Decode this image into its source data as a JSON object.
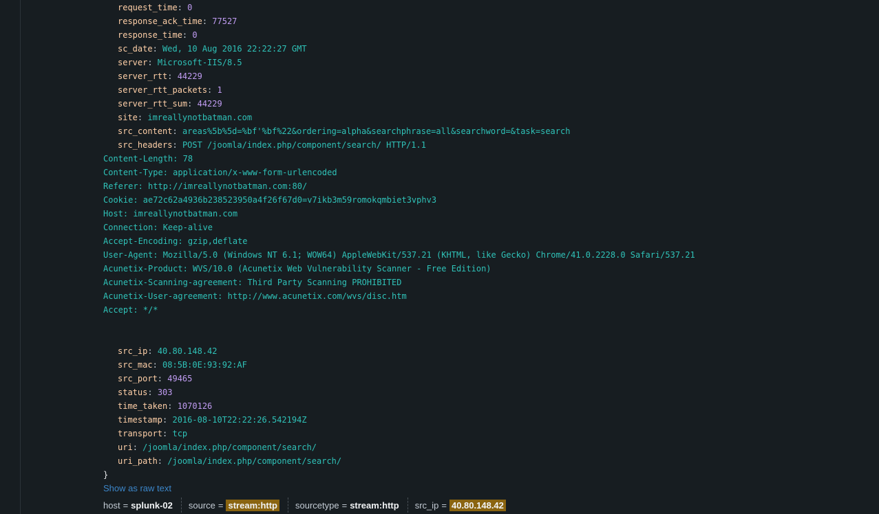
{
  "fields_top": [
    {
      "key": "request_time",
      "value": "0",
      "type": "num"
    },
    {
      "key": "response_ack_time",
      "value": "77527",
      "type": "num"
    },
    {
      "key": "response_time",
      "value": "0",
      "type": "num"
    },
    {
      "key": "sc_date",
      "value": "Wed, 10 Aug 2016 22:22:27 GMT",
      "type": "str"
    },
    {
      "key": "server",
      "value": "Microsoft-IIS/8.5",
      "type": "str"
    },
    {
      "key": "server_rtt",
      "value": "44229",
      "type": "num"
    },
    {
      "key": "server_rtt_packets",
      "value": "1",
      "type": "num"
    },
    {
      "key": "server_rtt_sum",
      "value": "44229",
      "type": "num"
    },
    {
      "key": "site",
      "value": "imreallynotbatman.com",
      "type": "str"
    },
    {
      "key": "src_content",
      "value": "areas%5b%5d=%bf'%bf%22&ordering=alpha&searchphrase=all&searchword=&task=search",
      "type": "str"
    },
    {
      "key": "src_headers",
      "value": "POST /joomla/index.php/component/search/ HTTP/1.1",
      "type": "str"
    }
  ],
  "header_lines": [
    "Content-Length: 78",
    "Content-Type: application/x-www-form-urlencoded",
    "Referer: http://imreallynotbatman.com:80/",
    "Cookie: ae72c62a4936b238523950a4f26f67d0=v7ikb3m59romokqmbiet3vphv3",
    "Host: imreallynotbatman.com",
    "Connection: Keep-alive",
    "Accept-Encoding: gzip,deflate",
    "User-Agent: Mozilla/5.0 (Windows NT 6.1; WOW64) AppleWebKit/537.21 (KHTML, like Gecko) Chrome/41.0.2228.0 Safari/537.21",
    "Acunetix-Product: WVS/10.0 (Acunetix Web Vulnerability Scanner - Free Edition)",
    "Acunetix-Scanning-agreement: Third Party Scanning PROHIBITED",
    "Acunetix-User-agreement: http://www.acunetix.com/wvs/disc.htm",
    "Accept: */*"
  ],
  "fields_bottom": [
    {
      "key": "src_ip",
      "value": "40.80.148.42",
      "type": "str"
    },
    {
      "key": "src_mac",
      "value": "08:5B:0E:93:92:AF",
      "type": "str"
    },
    {
      "key": "src_port",
      "value": "49465",
      "type": "num"
    },
    {
      "key": "status",
      "value": "303",
      "type": "num"
    },
    {
      "key": "time_taken",
      "value": "1070126",
      "type": "num"
    },
    {
      "key": "timestamp",
      "value": "2016-08-10T22:22:26.542194Z",
      "type": "str"
    },
    {
      "key": "transport",
      "value": "tcp",
      "type": "str"
    },
    {
      "key": "uri",
      "value": "/joomla/index.php/component/search/",
      "type": "str"
    },
    {
      "key": "uri_path",
      "value": "/joomla/index.php/component/search/",
      "type": "str"
    }
  ],
  "closing_brace": "}",
  "colon": ":",
  "show_raw_label": "Show as raw text",
  "meta": [
    {
      "key": "host",
      "value": "splunk-02",
      "highlighted": false
    },
    {
      "key": "source",
      "value": "stream:http",
      "highlighted": true
    },
    {
      "key": "sourcetype",
      "value": "stream:http",
      "highlighted": false
    },
    {
      "key": "src_ip",
      "value": "40.80.148.42",
      "highlighted": true
    }
  ],
  "meta_eq": "=",
  "colors": {
    "background": "#171d21",
    "key": "#ffd0a8",
    "string": "#2fc2b8",
    "number": "#c09cf2",
    "link": "#3c86c9",
    "highlight": "#8a6410"
  }
}
